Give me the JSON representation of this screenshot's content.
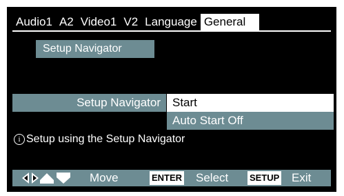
{
  "tabs": [
    {
      "label": "Audio1"
    },
    {
      "label": "A2"
    },
    {
      "label": "Video1"
    },
    {
      "label": "V2"
    },
    {
      "label": "Language"
    },
    {
      "label": "General"
    }
  ],
  "active_tab": "General",
  "section_title": "Setup Navigator",
  "setting": {
    "label": "Setup Navigator",
    "options": [
      {
        "label": "Start",
        "selected": true
      },
      {
        "label": "Auto Start Off",
        "selected": false
      }
    ]
  },
  "info": {
    "icon": "info-icon",
    "text": "Setup using the Setup Navigator"
  },
  "bottom_bar": {
    "arrow_icons": [
      "left-arrow-icon",
      "right-arrow-icon",
      "up-arrow-icon",
      "down-arrow-icon"
    ],
    "move_label": "Move",
    "enter_key": "ENTER",
    "select_label": "Select",
    "setup_key": "SETUP",
    "exit_label": "Exit"
  },
  "colors": {
    "background": "#000000",
    "panel": "#6d8c93",
    "highlight": "#ffffff"
  }
}
